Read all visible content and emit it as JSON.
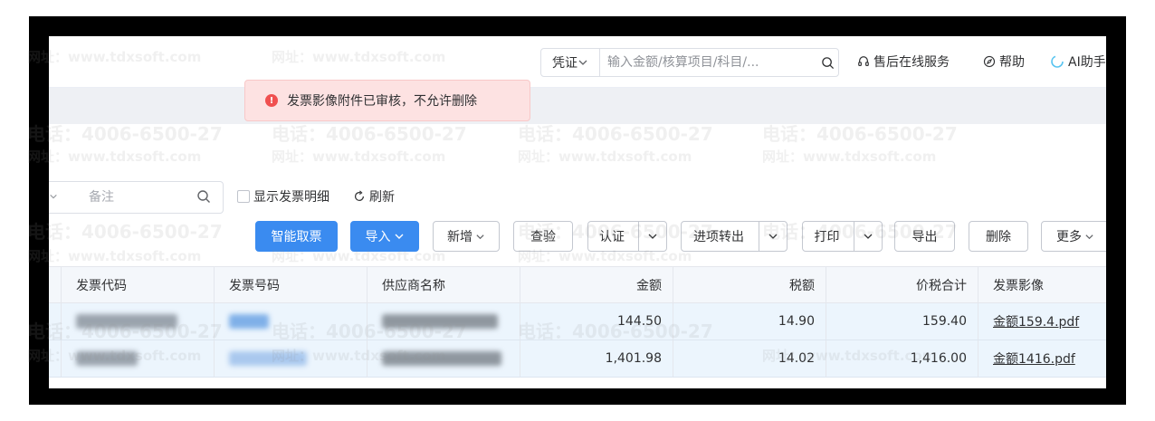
{
  "topbar": {
    "search_type": "凭证",
    "search_placeholder": "输入金额/核算项目/科目/...",
    "service_label": "售后在线服务",
    "help_label": "帮助",
    "ai_label": "AI助手"
  },
  "alert": {
    "message": "发票影像附件已审核，不允许删除"
  },
  "filter": {
    "remark_placeholder": "备注",
    "show_detail_label": "显示发票明细",
    "refresh_label": "刷新"
  },
  "toolbar": {
    "smart_fetch": "智能取票",
    "import": "导入",
    "add": "新增",
    "check": "查验",
    "certify": "认证",
    "transfer_out": "进项转出",
    "print": "打印",
    "export": "导出",
    "delete": "删除",
    "more": "更多"
  },
  "table": {
    "columns": [
      "发票代码",
      "发票号码",
      "供应商名称",
      "金额",
      "税额",
      "价税合计",
      "发票影像"
    ],
    "rows": [
      {
        "amount": "144.50",
        "tax": "14.90",
        "total": "159.40",
        "image": "金额159.4.pdf"
      },
      {
        "amount": "1,401.98",
        "tax": "14.02",
        "total": "1,416.00",
        "image": "金额1416.pdf"
      }
    ]
  },
  "watermark": {
    "phone": "电话：4006-6500-27",
    "site": "网址：www.tdxsoft.com"
  },
  "colors": {
    "primary": "#3a8bf0",
    "alert_bg": "#fde2e2",
    "alert_icon": "#f05050",
    "row_selected": "#ecf5fd"
  }
}
